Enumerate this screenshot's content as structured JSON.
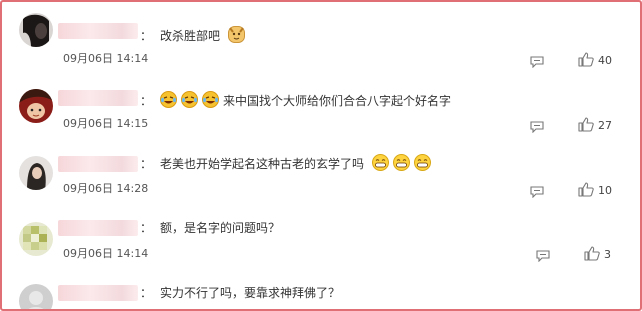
{
  "comments": [
    {
      "text": "改杀胜部吧",
      "emoji_after": [
        "dog-face-emoji"
      ],
      "emoji_before": [],
      "time": "09月06日 14:14",
      "likes": "40",
      "avatar_icon": "avatar-dark-hair-icon"
    },
    {
      "text": "来中国找个大师给你们合合八字起个好名字",
      "emoji_before": [
        "laughing-tears-emoji",
        "laughing-tears-emoji",
        "laughing-tears-emoji"
      ],
      "emoji_after": [],
      "time": "09月06日 14:15",
      "likes": "27",
      "avatar_icon": "avatar-cartoon-icon"
    },
    {
      "text": "老美也开始学起名这种古老的玄学了吗",
      "emoji_before": [],
      "emoji_after": [
        "grinning-emoji",
        "grinning-emoji",
        "grinning-emoji"
      ],
      "time": "09月06日 14:28",
      "likes": "10",
      "avatar_icon": "avatar-girl-icon"
    },
    {
      "text": "额，是名字的问题吗？",
      "emoji_before": [],
      "emoji_after": [],
      "time": "09月06日 14:14",
      "likes": "3",
      "avatar_icon": "avatar-blurred-icon"
    },
    {
      "text": "实力不行了吗，要靠求神拜佛了？",
      "emoji_before": [],
      "emoji_after": [],
      "time": "",
      "likes": "",
      "avatar_icon": "avatar-gray-icon"
    }
  ],
  "colors": {
    "frame_border": "#e06e75",
    "name_mask": "#f6d7da",
    "emoji_yellow": "#f6c22f"
  }
}
